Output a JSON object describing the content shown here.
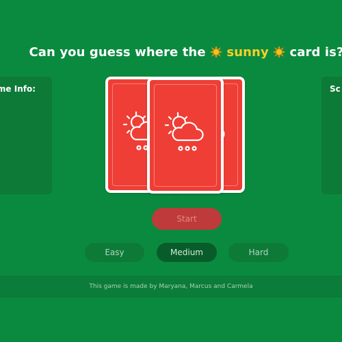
{
  "header": {
    "title_prefix": "Can you guess where the",
    "title_highlight": "sunny",
    "title_suffix": "card is?",
    "sun_icon": "sun-emoji-icon"
  },
  "panels": {
    "left_title": "me Info:",
    "right_title": "Sc"
  },
  "cards": [
    {
      "icon": "sun-cloud-snow-icon"
    },
    {
      "icon": "sun-cloud-snow-icon"
    },
    {
      "icon": "sun-cloud-snow-icon"
    }
  ],
  "controls": {
    "start_label": "Start",
    "difficulty": [
      {
        "label": "Easy",
        "selected": false
      },
      {
        "label": "Medium",
        "selected": true
      },
      {
        "label": "Hard",
        "selected": false
      }
    ]
  },
  "footer": {
    "credit": "This game is made by Maryana, Marcus and Carmela"
  },
  "colors": {
    "background": "#0a8a3f",
    "card_red": "#ee3e35",
    "highlight_yellow": "#f6d12a",
    "start_button": "#bf3a3a"
  }
}
